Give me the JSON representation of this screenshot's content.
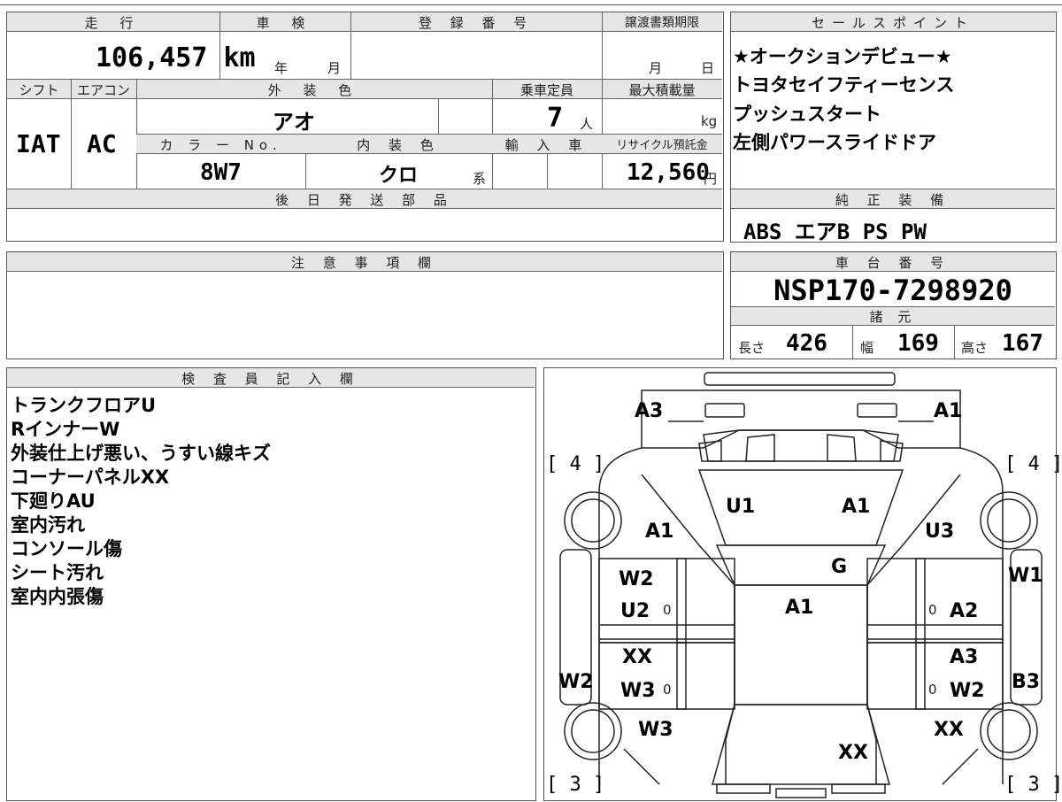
{
  "basic": {
    "mileage_label": "走 行",
    "mileage": "106,457 km",
    "shaken_label": "車 検",
    "shaken_year_unit": "年",
    "shaken_month_unit": "月",
    "reg_label": "登 録 番 号",
    "transfer_label": "譲渡書類期限",
    "transfer_month_unit": "月",
    "transfer_day_unit": "日",
    "shift_label": "シフト",
    "shift": "IAT",
    "ac_label": "エアコン",
    "ac": "AC",
    "ext_color_label": "外 装 色",
    "ext_color": "アオ",
    "capacity_label": "乗車定員",
    "capacity": "7",
    "capacity_unit": "人",
    "maxload_label": "最大積載量",
    "maxload_unit": "kg",
    "color_no_label": "カ ラ ー No.",
    "color_no": "8W7",
    "int_color_label": "内 装 色",
    "int_color": "クロ",
    "int_color_suffix": "系",
    "import_label": "輸 入 車",
    "recycle_label": "リサイクル預託金",
    "recycle": "12,560",
    "recycle_unit": "円",
    "later_parts_label": "後 日 発 送 部 品"
  },
  "sales_points": {
    "title": "セールスポイント",
    "items": [
      "★オークションデビュー★",
      "トヨタセイフティーセンス",
      "プッシュスタート",
      "左側パワースライドドア"
    ]
  },
  "equipment": {
    "title": "純 正 装 備",
    "value": "ABS エアB PS PW"
  },
  "notes": {
    "title": "注 意 事 項 欄"
  },
  "chassis": {
    "title": "車 台 番 号",
    "value": "NSP170-7298920",
    "specs_title": "諸 元",
    "length_label": "長さ",
    "length": "426",
    "width_label": "幅",
    "width": "169",
    "height_label": "高さ",
    "height": "167"
  },
  "inspector": {
    "title": "検 査 員 記 入 欄",
    "lines": [
      "トランクフロアU",
      "RインナーW",
      "外装仕上げ悪い、うすい線キズ",
      "コーナーパネルXX",
      "下廻りAU",
      "室内汚れ",
      "コンソール傷",
      "シート汚れ",
      "室内内張傷"
    ]
  },
  "diagram": {
    "labels": {
      "rear_left": "A3",
      "rear_right": "A1",
      "tire_rl": "[ 4 ]",
      "tire_rr": "[ 4 ]",
      "quarter_left": "A1",
      "roof_left": "U1",
      "roof_right": "A1",
      "quarter_right": "U3",
      "rear_window": "G",
      "door_l_upper": "W2",
      "door_l_upper2": "U2",
      "door_l_upper_small": "0",
      "roof_center": "A1",
      "door_r_upper_small": "0",
      "door_r_upper": "A2",
      "side_right_top": "W1",
      "door_l_lower": "XX",
      "door_l_lower2": "W3",
      "door_l_lower_small": "0",
      "door_r_lower": "A3",
      "door_r_lower_small": "0",
      "door_r_lower2": "W2",
      "side_left": "W2",
      "side_right": "B3",
      "fender_left": "W3",
      "fender_right": "XX",
      "hood": "XX",
      "tire_fl": "[ 3 ]",
      "tire_fr": "[ 3 ]"
    }
  }
}
